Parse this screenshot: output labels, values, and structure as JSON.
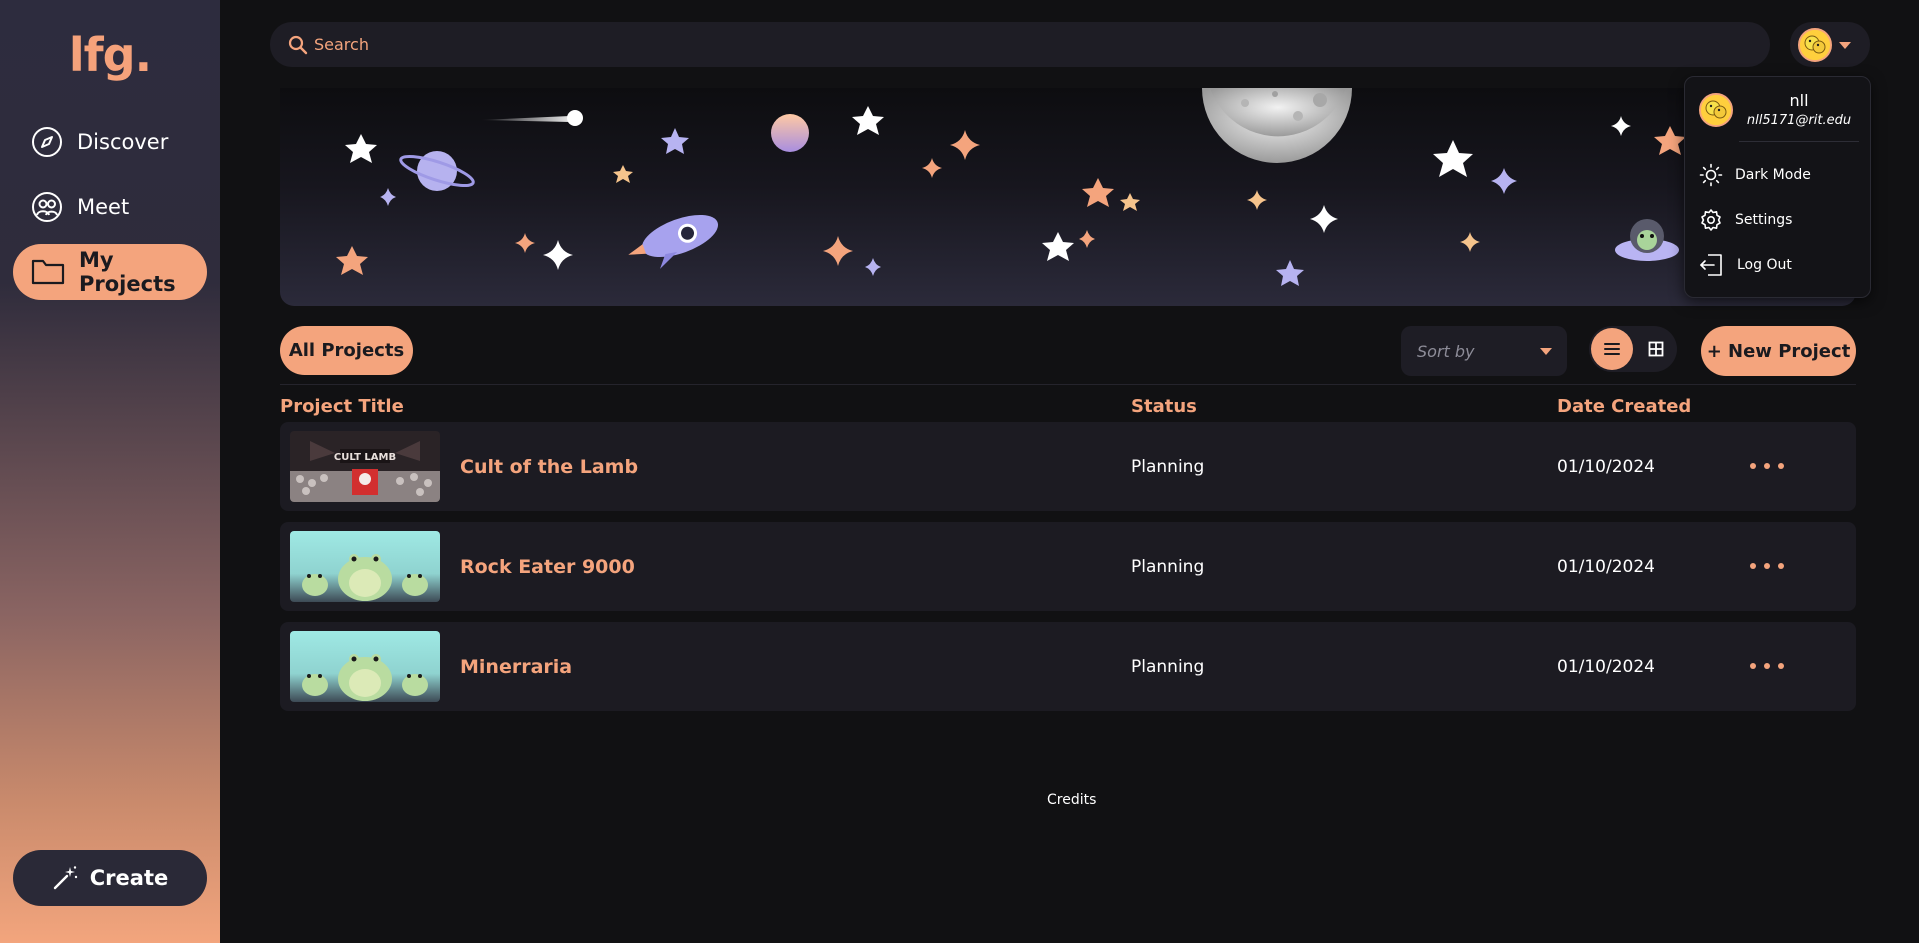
{
  "sidebar": {
    "logo": "lfg.",
    "items": [
      {
        "label": "Discover",
        "icon": "compass-icon"
      },
      {
        "label": "Meet",
        "icon": "people-icon"
      },
      {
        "label": "My Projects",
        "icon": "folder-icon",
        "active": true
      }
    ],
    "create_label": "Create"
  },
  "search": {
    "placeholder": "Search"
  },
  "account_menu": {
    "name": "nll",
    "email": "nll5171@rit.edu",
    "items": [
      {
        "label": "Dark Mode",
        "icon": "sun-icon"
      },
      {
        "label": "Settings",
        "icon": "gear-icon"
      },
      {
        "label": "Log Out",
        "icon": "logout-icon"
      }
    ]
  },
  "toolbar": {
    "all_projects_label": "All Projects",
    "sort_placeholder": "Sort by",
    "new_project_label": "+ New Project"
  },
  "table": {
    "columns": [
      "Project Title",
      "Status",
      "Date Created"
    ],
    "rows": [
      {
        "title": "Cult of the Lamb",
        "status": "Planning",
        "date": "01/10/2024",
        "thumbnail": "cult-of-the-lamb-art"
      },
      {
        "title": "Rock Eater 9000",
        "status": "Planning",
        "date": "01/10/2024",
        "thumbnail": "frog-art"
      },
      {
        "title": "Minerraria",
        "status": "Planning",
        "date": "01/10/2024",
        "thumbnail": "frog-art"
      }
    ]
  },
  "footer": {
    "credits_label": "Credits"
  },
  "colors": {
    "accent": "#f4a47d",
    "background": "#111113",
    "row_background": "#1c1b22",
    "sidebar_top": "#2d2c3e",
    "sidebar_bottom": "#f3a57d"
  }
}
